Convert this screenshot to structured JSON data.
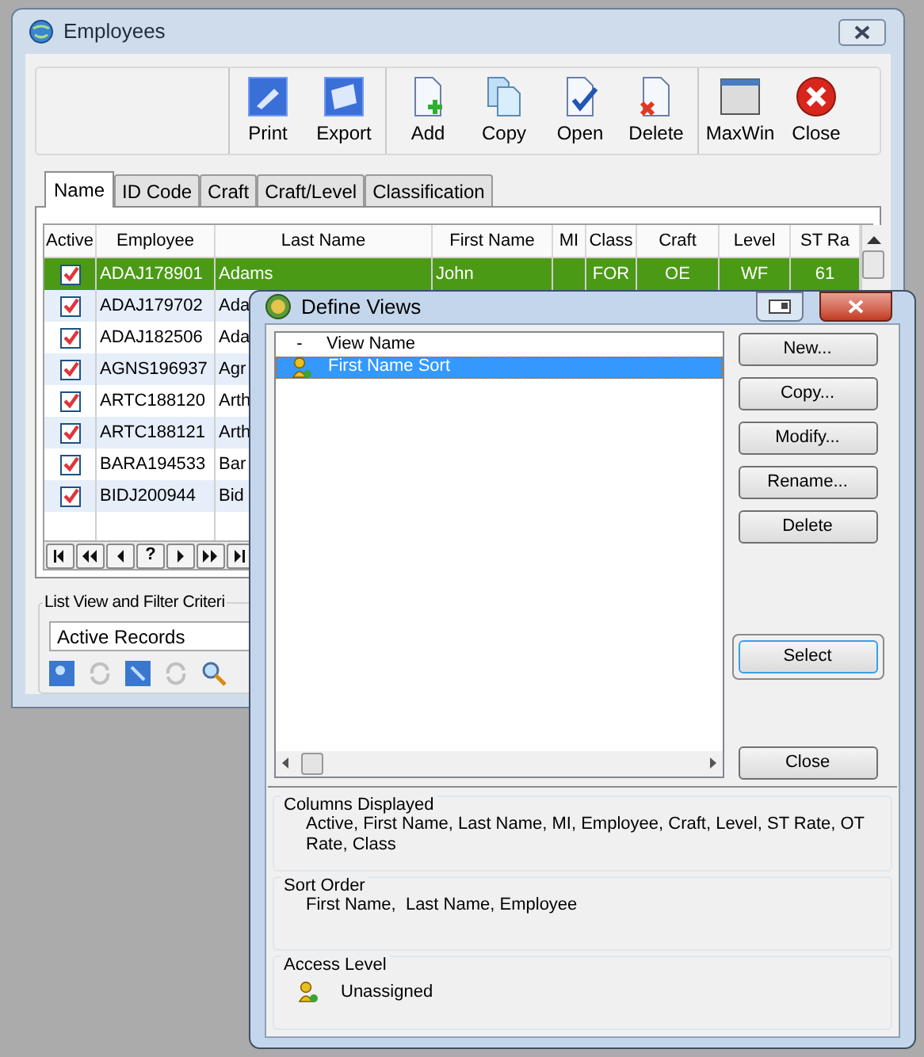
{
  "employees_window": {
    "title": "Employees",
    "toolbar": [
      {
        "label": "Print",
        "kind": "print"
      },
      {
        "label": "Export",
        "kind": "export"
      },
      {
        "label": "Add",
        "kind": "add"
      },
      {
        "label": "Copy",
        "kind": "copy"
      },
      {
        "label": "Open",
        "kind": "open"
      },
      {
        "label": "Delete",
        "kind": "delete"
      },
      {
        "label": "MaxWin",
        "kind": "maxwin"
      },
      {
        "label": "Close",
        "kind": "close"
      }
    ],
    "tabs": [
      {
        "label": "Name",
        "selected": true
      },
      {
        "label": "ID Code",
        "selected": false
      },
      {
        "label": "Craft",
        "selected": false
      },
      {
        "label": "Craft/Level",
        "selected": false
      },
      {
        "label": "Classification",
        "selected": false
      }
    ],
    "table": {
      "columns": [
        "Active",
        "Employee",
        "Last Name",
        "First Name",
        "MI",
        "Class",
        "Craft",
        "Level",
        "ST Ra"
      ],
      "rows": [
        {
          "active": true,
          "selected": true,
          "cells": [
            "",
            "ADAJ178901",
            "Adams",
            "John",
            "",
            "FOR",
            "OE",
            "WF",
            "61"
          ]
        },
        {
          "active": true,
          "selected": false,
          "cells": [
            "",
            "ADAJ179702",
            "Ada"
          ]
        },
        {
          "active": true,
          "selected": false,
          "cells": [
            "",
            "ADAJ182506",
            "Ada"
          ]
        },
        {
          "active": true,
          "selected": false,
          "cells": [
            "",
            "AGNS196937",
            "Agr"
          ]
        },
        {
          "active": true,
          "selected": false,
          "cells": [
            "",
            "ARTC188120",
            "Arth"
          ]
        },
        {
          "active": true,
          "selected": false,
          "cells": [
            "",
            "ARTC188121",
            "Arth"
          ]
        },
        {
          "active": true,
          "selected": false,
          "cells": [
            "",
            "BARA194533",
            "Bar"
          ]
        },
        {
          "active": true,
          "selected": false,
          "cells": [
            "",
            "BIDJ200944",
            "Bid"
          ]
        }
      ]
    },
    "pager": [
      {
        "kind": "first"
      },
      {
        "kind": "prev_page"
      },
      {
        "kind": "prev"
      },
      {
        "kind": "find",
        "label": "?"
      },
      {
        "kind": "next"
      },
      {
        "kind": "next_page"
      },
      {
        "kind": "last"
      }
    ],
    "filter": {
      "label": "List View and Filter Criteri",
      "value": "Active Records"
    }
  },
  "define_views": {
    "title": "Define Views",
    "list": {
      "columns": [
        "-",
        "View Name"
      ],
      "rows": [
        {
          "name": "First Name Sort",
          "selected": true
        }
      ]
    },
    "buttons": [
      {
        "label": "New...",
        "default": false
      },
      {
        "label": "Copy...",
        "default": false
      },
      {
        "label": "Modify...",
        "default": false
      },
      {
        "label": "Rename...",
        "default": false
      },
      {
        "label": "Delete",
        "default": false
      },
      {
        "label": "Select",
        "default": true
      },
      {
        "label": "Close",
        "default": false
      }
    ],
    "columns_displayed": {
      "label": "Columns Displayed",
      "text": "Active, First Name, Last Name, MI, Employee, Craft, Level, ST Rate, OT Rate, Class"
    },
    "sort_order": {
      "label": "Sort Order",
      "text": "First Name,  Last Name, Employee"
    },
    "access_level": {
      "label": "Access Level",
      "text": "Unassigned"
    }
  }
}
